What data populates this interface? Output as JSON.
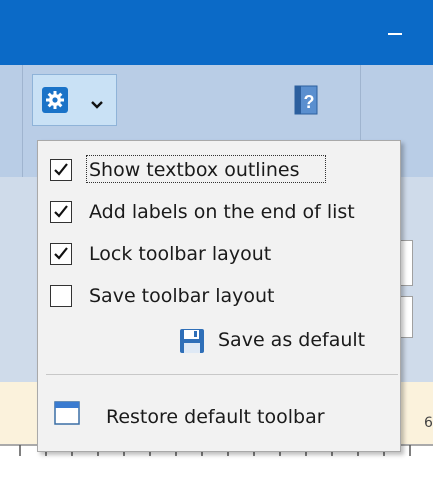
{
  "window": {
    "minimize_icon": "minimize-icon",
    "accent_color": "#0b6ac7"
  },
  "toolbar": {
    "settings_icon": "gear-icon",
    "dropdown_icon": "chevron-down-icon",
    "help_icon": "help-icon",
    "help_glyph": "?"
  },
  "menu": {
    "items": [
      {
        "label": "Show textbox outlines",
        "checked": true
      },
      {
        "label": "Add labels on the end of list",
        "checked": true
      },
      {
        "label": "Lock toolbar layout",
        "checked": true
      },
      {
        "label": "Save toolbar layout",
        "checked": false
      }
    ],
    "save_default_label": "Save as default",
    "save_default_icon": "floppy-disk-icon",
    "restore_label": "Restore default toolbar",
    "restore_icon": "window-icon"
  },
  "ruler": {
    "number": "6"
  }
}
